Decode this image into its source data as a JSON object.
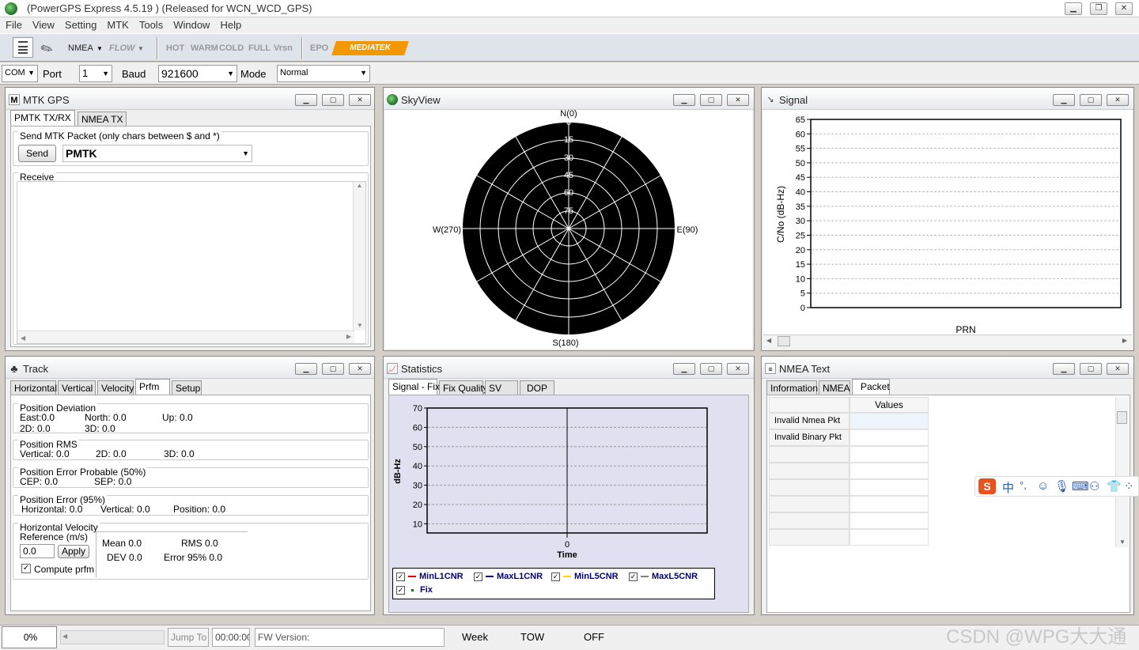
{
  "app": {
    "title": "(PowerGPS Express 4.5.19 ) (Released for WCN_WCD_GPS)",
    "win_min": "▁",
    "win_restore": "❐",
    "win_close": "✕"
  },
  "menu": [
    "File",
    "View",
    "Setting",
    "MTK",
    "Tools",
    "Window",
    "Help"
  ],
  "toolbar": {
    "nmea": "NMEA",
    "flow": "FLOW",
    "hot": "HOT",
    "warm": "WARM",
    "cold": "COLD",
    "full": "FULL",
    "vrsn": "Vrsn",
    "epo": "EPO",
    "brand": "MEDIATEK"
  },
  "connection": {
    "com": "COM",
    "port_label": "Port",
    "port": "1",
    "baud_label": "Baud",
    "baud": "921600",
    "mode_label": "Mode",
    "mode": "Normal"
  },
  "mtk_gps": {
    "title": "MTK GPS",
    "tab_txrx": "PMTK TX/RX",
    "tab_nmea_tx": "NMEA TX",
    "send_group": "Send MTK Packet (only chars between $ and *)",
    "send_button": "Send",
    "packet_value": "PMTK",
    "receive_label": "Receive"
  },
  "skyview": {
    "title": "SkyView",
    "north": "N(0)",
    "south": "S(180)",
    "east": "E(90)",
    "west": "W(270)",
    "ring_labels": [
      "0",
      "15",
      "30",
      "45",
      "60",
      "75"
    ]
  },
  "signal": {
    "title": "Signal",
    "ylabel": "C/No (dB-Hz)",
    "xlabel": "PRN",
    "yticks": [
      "65",
      "60",
      "55",
      "50",
      "45",
      "40",
      "35",
      "30",
      "25",
      "20",
      "15",
      "10",
      "5",
      "0"
    ]
  },
  "track": {
    "title": "Track",
    "tabs": [
      "Horizontal",
      "Vertical",
      "Velocity",
      "Prfm",
      "Setup"
    ],
    "pos_dev": {
      "label": "Position Deviation",
      "east": "East:0.0",
      "north": "North: 0.0",
      "up": "Up: 0.0",
      "d2": "2D:  0.0",
      "d3": "3D:    0.0"
    },
    "pos_rms": {
      "label": "Position RMS",
      "vertical": "Vertical: 0.0",
      "d2": "2D:  0.0",
      "d3": "3D:  0.0"
    },
    "pos_err50": {
      "label": "Position Error Probable (50%)",
      "cep": "CEP:  0.0",
      "sep": "SEP:  0.0"
    },
    "pos_err95": {
      "label": "Position Error (95%)",
      "horizontal": "Horizontal:  0.0",
      "vertical": "Vertical: 0.0",
      "position": "Position: 0.0"
    },
    "hvel": {
      "label": "Horizontal Velocity",
      "ref_label": "Reference (m/s)",
      "ref_value": "0.0",
      "apply": "Apply",
      "mean": "Mean   0.0",
      "rms": "RMS    0.0",
      "dev": "DEV    0.0",
      "err95": "Error 95%   0.0",
      "compute": "Compute prfm"
    }
  },
  "statistics": {
    "title": "Statistics",
    "tabs": [
      "Signal - Fix",
      "Fix Quality",
      "SV",
      "DOP"
    ],
    "ylabel": "dB-Hz",
    "xlabel": "Time",
    "xtick": "0",
    "yticks": [
      "70",
      "60",
      "50",
      "40",
      "30",
      "20",
      "10"
    ],
    "legend": [
      {
        "name": "MinL1CNR",
        "color": "#e00000"
      },
      {
        "name": "MaxL1CNR",
        "color": "#000080"
      },
      {
        "name": "MinL5CNR",
        "color": "#ffd800"
      },
      {
        "name": "MaxL5CNR",
        "color": "#808080"
      },
      {
        "name": "Fix",
        "color": "#008000"
      }
    ]
  },
  "nmea_text": {
    "title": "NMEA Text",
    "tabs": [
      "Information",
      "NMEA",
      "Packet"
    ],
    "col_values": "Values",
    "rows": [
      "Invalid Nmea Pkt",
      "Invalid Binary Pkt"
    ]
  },
  "status": {
    "progress": "0%",
    "jump_to": "Jump To",
    "time": "00:00:00",
    "fw": "FW Version:",
    "week": "Week",
    "tow": "TOW",
    "off": "OFF"
  },
  "watermark": "CSDN @WPG大大通",
  "ime": {
    "lang": "中",
    "punct": "°,"
  }
}
